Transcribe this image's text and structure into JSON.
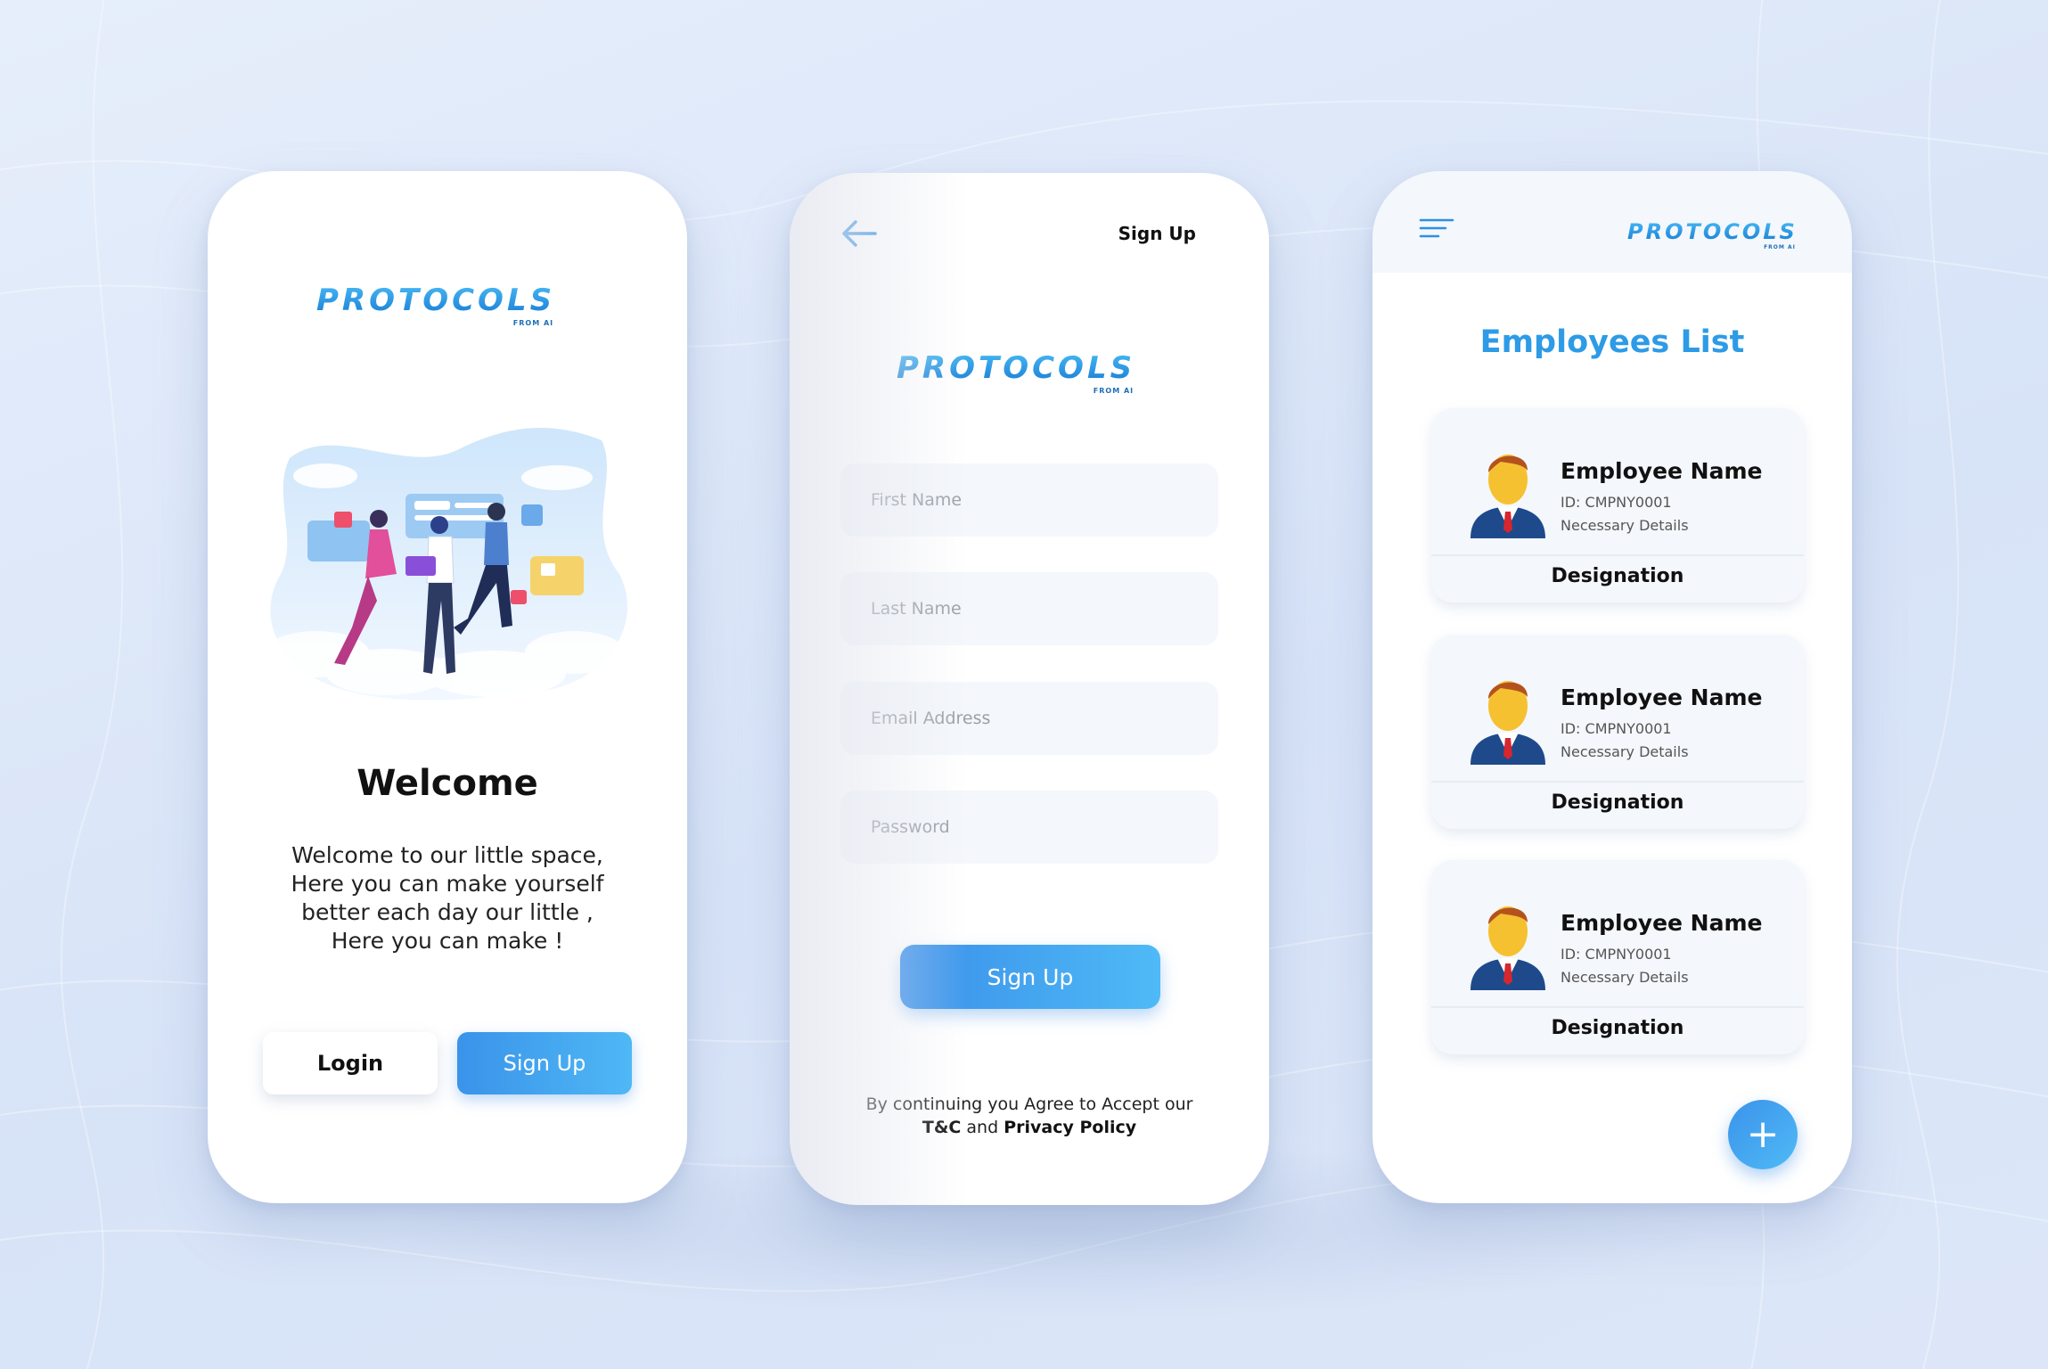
{
  "brand": {
    "logo_text": "PROTOCOLS",
    "logo_sub": "FROM AI",
    "accent": "#2d9be6",
    "button_gradient": [
      "#3a93ea",
      "#4fb8f5"
    ]
  },
  "welcome_screen": {
    "title": "Welcome",
    "body": "Welcome to our little space,\nHere you can make yourself\nbetter each day our little ,\nHere you can make !",
    "login_label": "Login",
    "signup_label": "Sign Up",
    "illustration_icon": "team-illustration"
  },
  "signup_screen": {
    "header": "Sign Up",
    "back_icon": "arrow-left-icon",
    "fields": {
      "first_name": "First Name",
      "last_name": "Last Name",
      "email": "Email Address",
      "password": "Password"
    },
    "submit_label": "Sign Up",
    "terms_prefix": "By continuing you Agree to Accept our",
    "terms_tc": "T&C",
    "terms_and": "and",
    "terms_privacy": "Privacy Policy"
  },
  "employees_screen": {
    "menu_icon": "hamburger-menu-icon",
    "title": "Employees List",
    "employees": [
      {
        "name": "Employee Name",
        "id": "ID: CMPNY0001",
        "details": "Necessary Details",
        "designation": "Designation"
      },
      {
        "name": "Employee Name",
        "id": "ID: CMPNY0001",
        "details": "Necessary Details",
        "designation": "Designation"
      },
      {
        "name": "Employee Name",
        "id": "ID: CMPNY0001",
        "details": "Necessary Details",
        "designation": "Designation"
      }
    ],
    "fab_label": "+"
  }
}
